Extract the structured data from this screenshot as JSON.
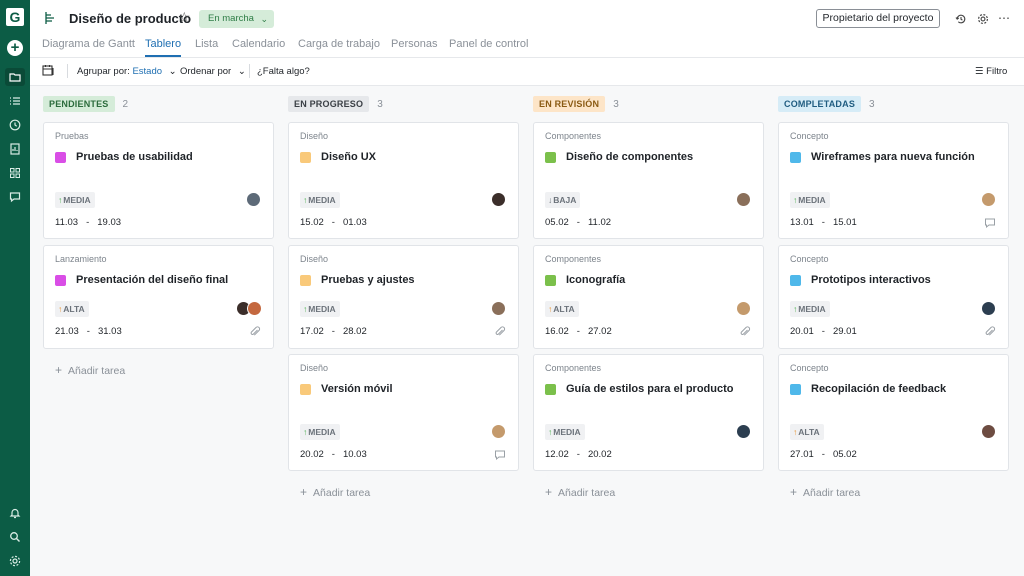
{
  "header": {
    "title": "Diseño de producto",
    "status": "En marcha",
    "owner_button": "Propietario del proyecto"
  },
  "tabs": [
    {
      "label": "Diagrama de Gantt"
    },
    {
      "label": "Tablero"
    },
    {
      "label": "Lista"
    },
    {
      "label": "Calendario"
    },
    {
      "label": "Carga de trabajo"
    },
    {
      "label": "Personas"
    },
    {
      "label": "Panel de control"
    }
  ],
  "toolbar": {
    "group_label": "Agrupar por:",
    "group_value": "Estado",
    "sort_label": "Ordenar por",
    "missing": "¿Falta algo?",
    "filter": "Filtro"
  },
  "add_task_label": "Añadir tarea",
  "colors": {
    "brand": "#0c5c45",
    "accent": "#1f6fb2",
    "pendientes": "#d5ecd9",
    "en_progreso": "#e6e8eb",
    "en_revision": "#fde5c8",
    "completadas": "#d6ecf7"
  },
  "columns": [
    {
      "name": "PENDIENTES",
      "count": "2",
      "cards": [
        {
          "category": "Pruebas",
          "title": "Pruebas de usabilidad",
          "color": "#d94ee6",
          "priority": "MEDIA",
          "priority_dir": "up",
          "start": "11.03",
          "end": "19.03"
        },
        {
          "category": "Lanzamiento",
          "title": "Presentación del diseño final",
          "color": "#d94ee6",
          "priority": "ALTA",
          "priority_dir": "up",
          "start": "21.03",
          "end": "31.03"
        }
      ]
    },
    {
      "name": "EN PROGRESO",
      "count": "3",
      "cards": [
        {
          "category": "Diseño",
          "title": "Diseño UX",
          "color": "#f9c97a",
          "priority": "MEDIA",
          "priority_dir": "up",
          "start": "15.02",
          "end": "01.03"
        },
        {
          "category": "Diseño",
          "title": "Pruebas y ajustes",
          "color": "#f9c97a",
          "priority": "MEDIA",
          "priority_dir": "up",
          "start": "17.02",
          "end": "28.02"
        },
        {
          "category": "Diseño",
          "title": "Versión móvil",
          "color": "#f9c97a",
          "priority": "MEDIA",
          "priority_dir": "up",
          "start": "20.02",
          "end": "10.03"
        }
      ]
    },
    {
      "name": "EN REVISIÓN",
      "count": "3",
      "cards": [
        {
          "category": "Componentes",
          "title": "Diseño de componentes",
          "color": "#7bc04b",
          "priority": "BAJA",
          "priority_dir": "down",
          "start": "05.02",
          "end": "11.02"
        },
        {
          "category": "Componentes",
          "title": "Iconografía",
          "color": "#7bc04b",
          "priority": "ALTA",
          "priority_dir": "up",
          "start": "16.02",
          "end": "27.02"
        },
        {
          "category": "Componentes",
          "title": "Guía de estilos para el producto",
          "color": "#7bc04b",
          "priority": "MEDIA",
          "priority_dir": "up",
          "start": "12.02",
          "end": "20.02"
        }
      ]
    },
    {
      "name": "COMPLETADAS",
      "count": "3",
      "cards": [
        {
          "category": "Concepto",
          "title": "Wireframes para nueva función",
          "color": "#4fb8ea",
          "priority": "MEDIA",
          "priority_dir": "up",
          "start": "13.01",
          "end": "15.01"
        },
        {
          "category": "Concepto",
          "title": "Prototipos interactivos",
          "color": "#4fb8ea",
          "priority": "MEDIA",
          "priority_dir": "up",
          "start": "20.01",
          "end": "29.01"
        },
        {
          "category": "Concepto",
          "title": "Recopilación de feedback",
          "color": "#4fb8ea",
          "priority": "ALTA",
          "priority_dir": "up",
          "start": "27.01",
          "end": "05.02"
        }
      ]
    }
  ]
}
